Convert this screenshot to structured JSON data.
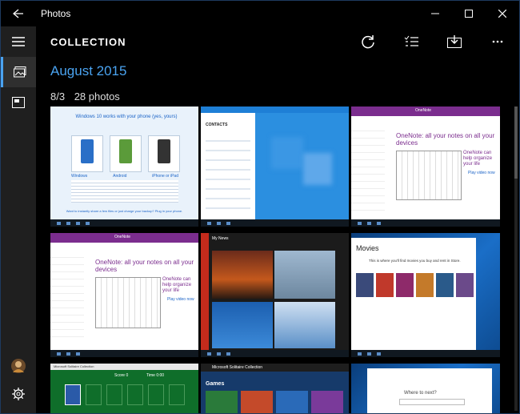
{
  "app": {
    "title": "Photos"
  },
  "header": {
    "title": "COLLECTION"
  },
  "main": {
    "month": "August 2015",
    "date": "8/3",
    "count": "28 photos"
  },
  "tiles": {
    "t1": {
      "title": "Windows 10 works with your phone (yes, yours)",
      "cols": [
        "Windows",
        "Android",
        "iPhone or iPad"
      ],
      "footer": "Want to instantly share a few files or just charge your backup? Plug in your phone."
    },
    "t2": {
      "header": "CONTACTS"
    },
    "t3": {
      "app": "OneNote",
      "headline": "OneNote: all your notes on all your devices",
      "sub": "OneNote can help organize your life",
      "link": "Play video now"
    },
    "t4": {
      "app": "OneNote",
      "headline": "OneNote: all your notes on all your devices",
      "sub": "OneNote can help organize your life",
      "link": "Play video now"
    },
    "t5": {
      "app": "My News"
    },
    "t6": {
      "heading": "Movies",
      "text": "This is where you'll find movies you buy and rent in Store."
    },
    "t7": {
      "app": "Microsoft Solitaire Collection",
      "score": "Score 0",
      "time": "Time 0:00"
    },
    "t8": {
      "app": "Microsoft Solitaire Collection",
      "section": "Games"
    },
    "t9": {
      "prompt": "Where to next?"
    }
  },
  "colors": {
    "accent": "#4aa3f0",
    "onenote": "#7b2d8e",
    "desktop": "#1a6ec7"
  }
}
